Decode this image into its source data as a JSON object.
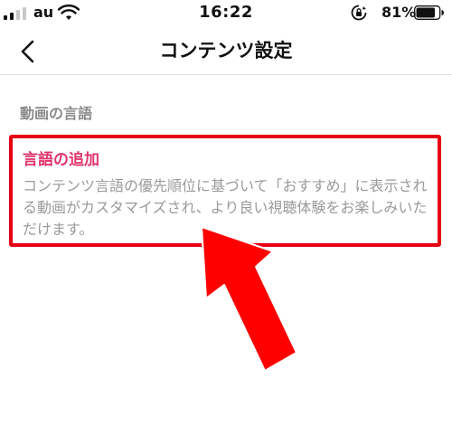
{
  "status_bar": {
    "carrier": "au",
    "time": "16:22",
    "battery_percent": "81%",
    "signal_bars_active": 2,
    "signal_bars_total": 4,
    "battery_level": 0.81
  },
  "nav": {
    "back_icon": "chevron-left-icon",
    "title": "コンテンツ設定"
  },
  "section": {
    "header": "動画の言語",
    "item": {
      "title": "言語の追加",
      "description": "コンテンツ言語の優先順位に基づいて「おすすめ」に表示される動画がカスタマイズされ、より良い視聴体験をお楽しみいただけます。"
    }
  },
  "colors": {
    "highlight_border": "#e60012",
    "arrow": "#ff0000",
    "item_title": "#e0336a",
    "secondary_text": "#9a9a9a"
  }
}
